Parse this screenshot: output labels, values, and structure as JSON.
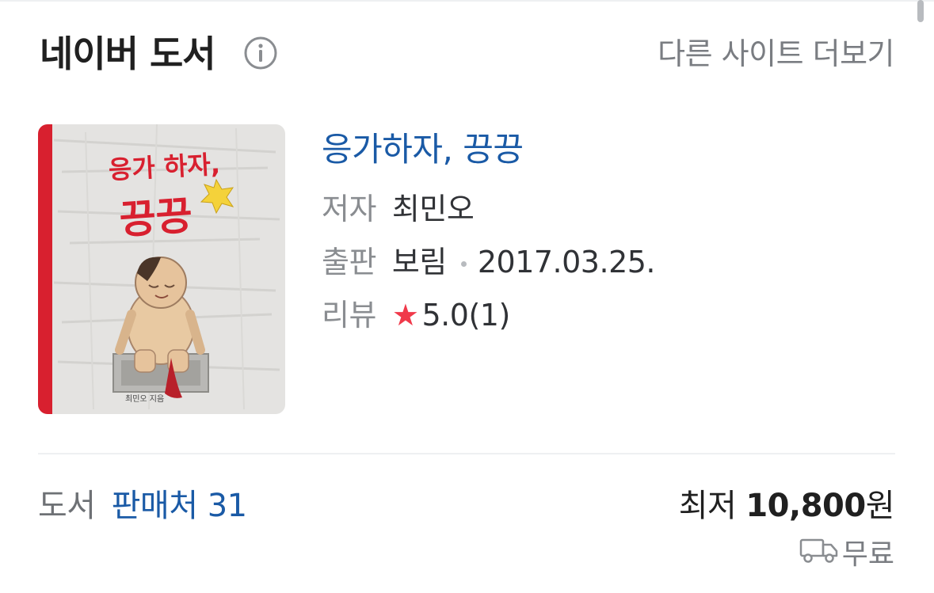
{
  "header": {
    "title": "네이버 도서",
    "more_sites": "다른 사이트 더보기"
  },
  "book": {
    "title": "응가하자, 끙끙",
    "cover": {
      "title_line1": "응가 하자,",
      "title_line2": "끙끙",
      "author_caption": "최민오 지음"
    },
    "author_label": "저자",
    "author": "최민오",
    "publisher_label": "출판",
    "publisher": "보림",
    "pub_date": "2017.03.25.",
    "review_label": "리뷰",
    "rating": "5.0",
    "review_count": "(1)"
  },
  "footer": {
    "category": "도서",
    "sellers": "판매처 31",
    "price_label": "최저",
    "price": "10,800",
    "currency": "원",
    "shipping": "무료"
  },
  "colors": {
    "link_blue": "#1a5aa6",
    "star_red": "#f0394a",
    "cover_red_spine": "#d8202f"
  },
  "icons": [
    "info-icon",
    "star-icon",
    "truck-icon"
  ]
}
